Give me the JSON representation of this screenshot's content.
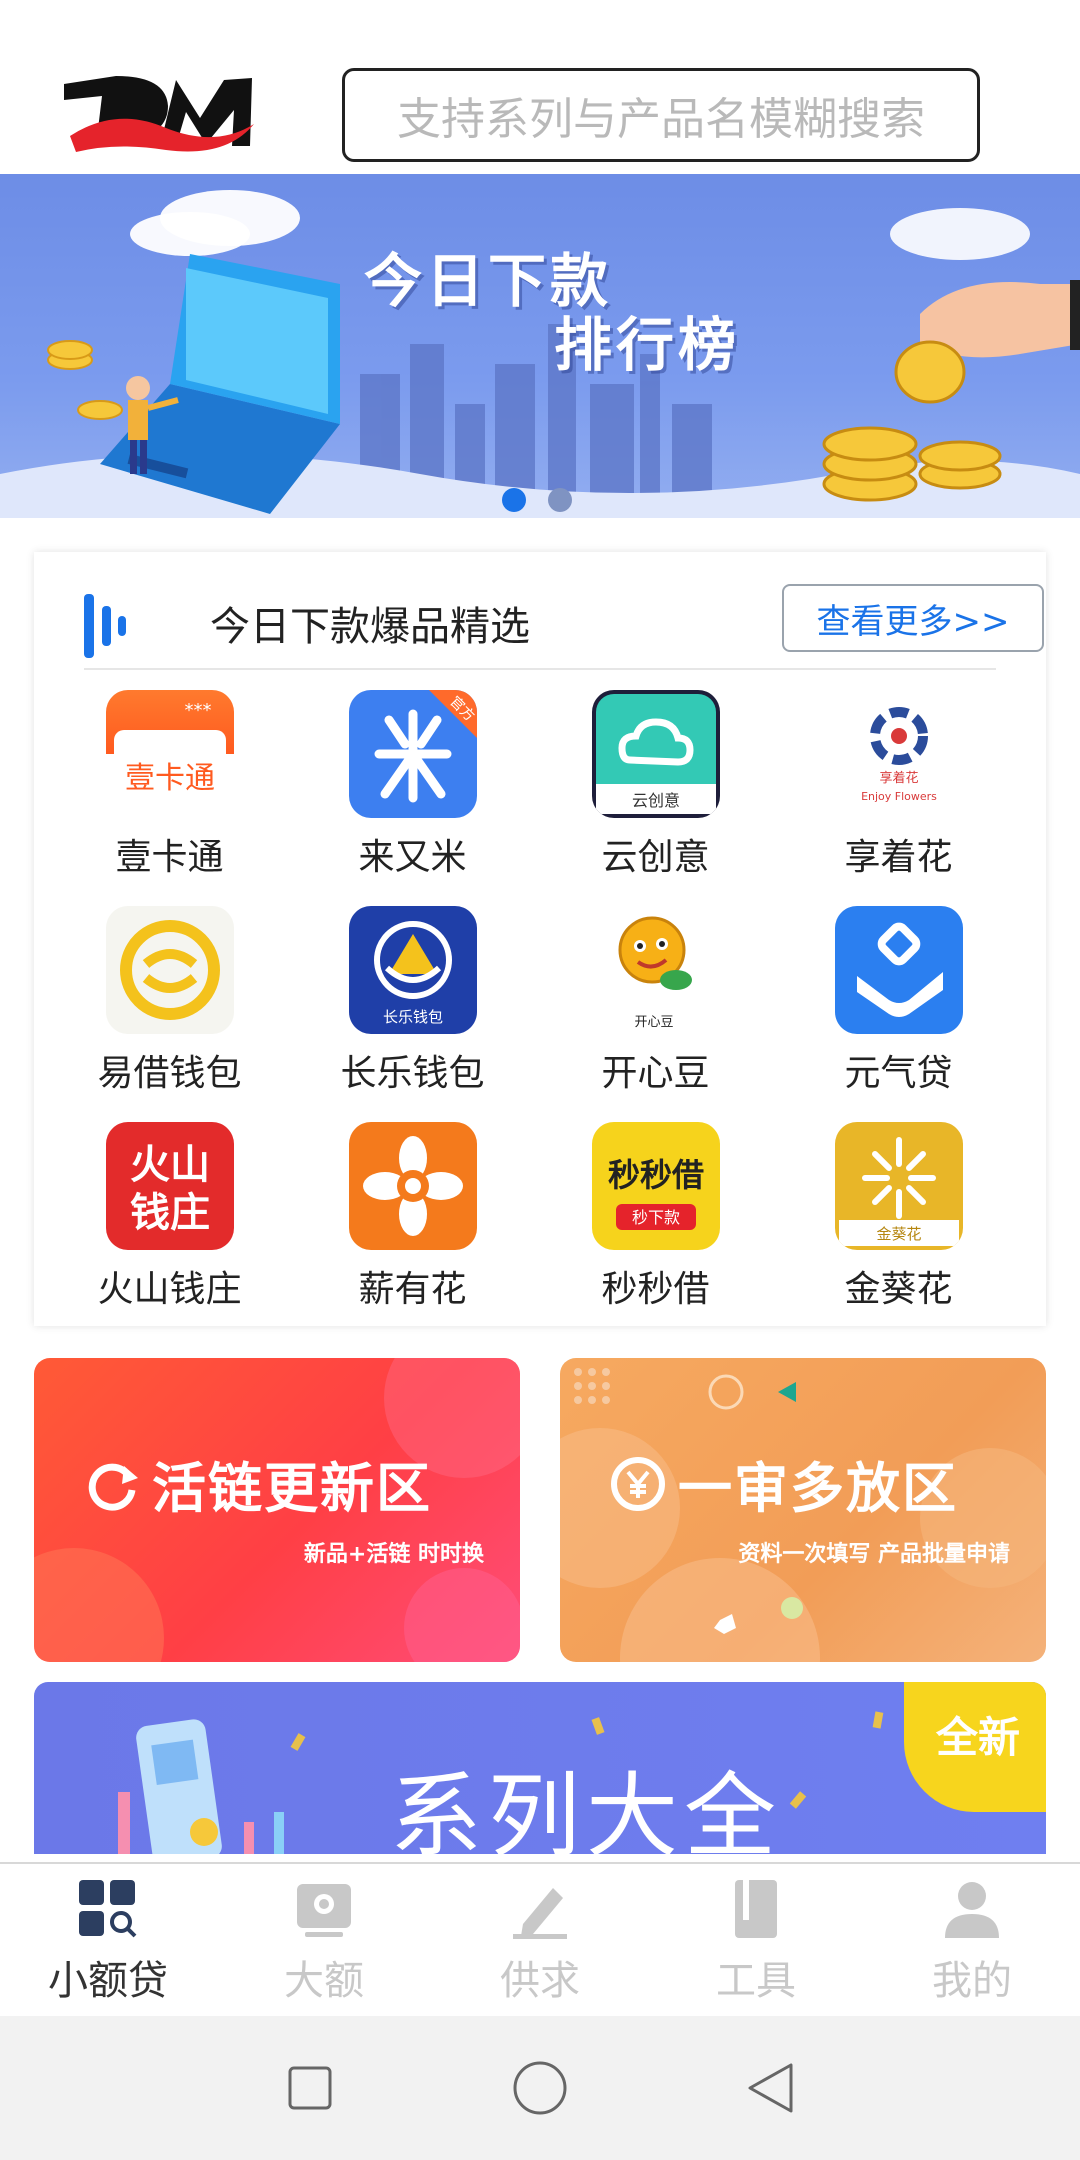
{
  "header": {
    "logo_text": "DM",
    "search_placeholder": "支持系列与产品名模糊搜索"
  },
  "banner": {
    "title_line1": "今日下款",
    "title_line2": "排行榜",
    "slide_count": 2,
    "active_slide": 1
  },
  "hot_picks": {
    "title": "今日下款爆品精选",
    "more_label": "查看更多>>",
    "apps": [
      {
        "name": "壹卡通",
        "icon": "yikatong-icon",
        "color": "#ff6a2b"
      },
      {
        "name": "来又米",
        "icon": "laiyoumi-icon",
        "color": "#3d7ff0",
        "badge": "官方"
      },
      {
        "name": "云创意",
        "icon": "cloud-icon",
        "color": "#32c7b3"
      },
      {
        "name": "享着花",
        "icon": "flower-swirl-icon",
        "color": "#2b4c9b"
      },
      {
        "name": "易借钱包",
        "icon": "yijie-wallet-icon",
        "color": "#f4c21c"
      },
      {
        "name": "长乐钱包",
        "icon": "changle-wallet-icon",
        "color": "#1f3fa8"
      },
      {
        "name": "开心豆",
        "icon": "happy-bean-icon",
        "color": "#f7b016"
      },
      {
        "name": "元气贷",
        "icon": "yuanqi-icon",
        "color": "#2b7ff0"
      },
      {
        "name": "火山钱庄",
        "icon": "volcano-icon",
        "color": "#e32b2b"
      },
      {
        "name": "薪有花",
        "icon": "xinyouhua-icon",
        "color": "#f47a1c"
      },
      {
        "name": "秒秒借",
        "icon": "miaomiaojie-icon",
        "color": "#f6d31c"
      },
      {
        "name": "金葵花",
        "icon": "sunflower-icon",
        "color": "#e8b628"
      }
    ],
    "icon_texts": {
      "yikatong": "壹卡通",
      "changle": "长乐钱包",
      "cloud": "云创意",
      "xiangzhe": "享着花",
      "kaixin": "开心豆",
      "huoshan_top": "火山",
      "huoshan_bottom": "钱庄",
      "miaomiao_top": "秒秒借",
      "miaomiao_bottom": "秒下款",
      "sunflower": "金葵花"
    }
  },
  "zones": {
    "left": {
      "title": "活链更新区",
      "subtitle": "新品+活链 时时换"
    },
    "right": {
      "title": "一审多放区",
      "subtitle": "资料一次填写 产品批量申请"
    }
  },
  "series": {
    "title": "系列大全",
    "badge": "全新"
  },
  "tabbar": {
    "tabs": [
      {
        "label": "小额贷",
        "icon": "grid-search-icon",
        "active": true
      },
      {
        "label": "大额",
        "icon": "camera-card-icon",
        "active": false
      },
      {
        "label": "供求",
        "icon": "pencil-icon",
        "active": false
      },
      {
        "label": "工具",
        "icon": "book-icon",
        "active": false
      },
      {
        "label": "我的",
        "icon": "person-icon",
        "active": false
      }
    ]
  },
  "colors": {
    "accent": "#1a73e8",
    "banner_blue": "#7b9bee",
    "zone_left": "#ff3f45",
    "zone_right": "#f29d57",
    "series_blue": "#6f7ff0",
    "badge_yellow": "#f7d51d"
  }
}
